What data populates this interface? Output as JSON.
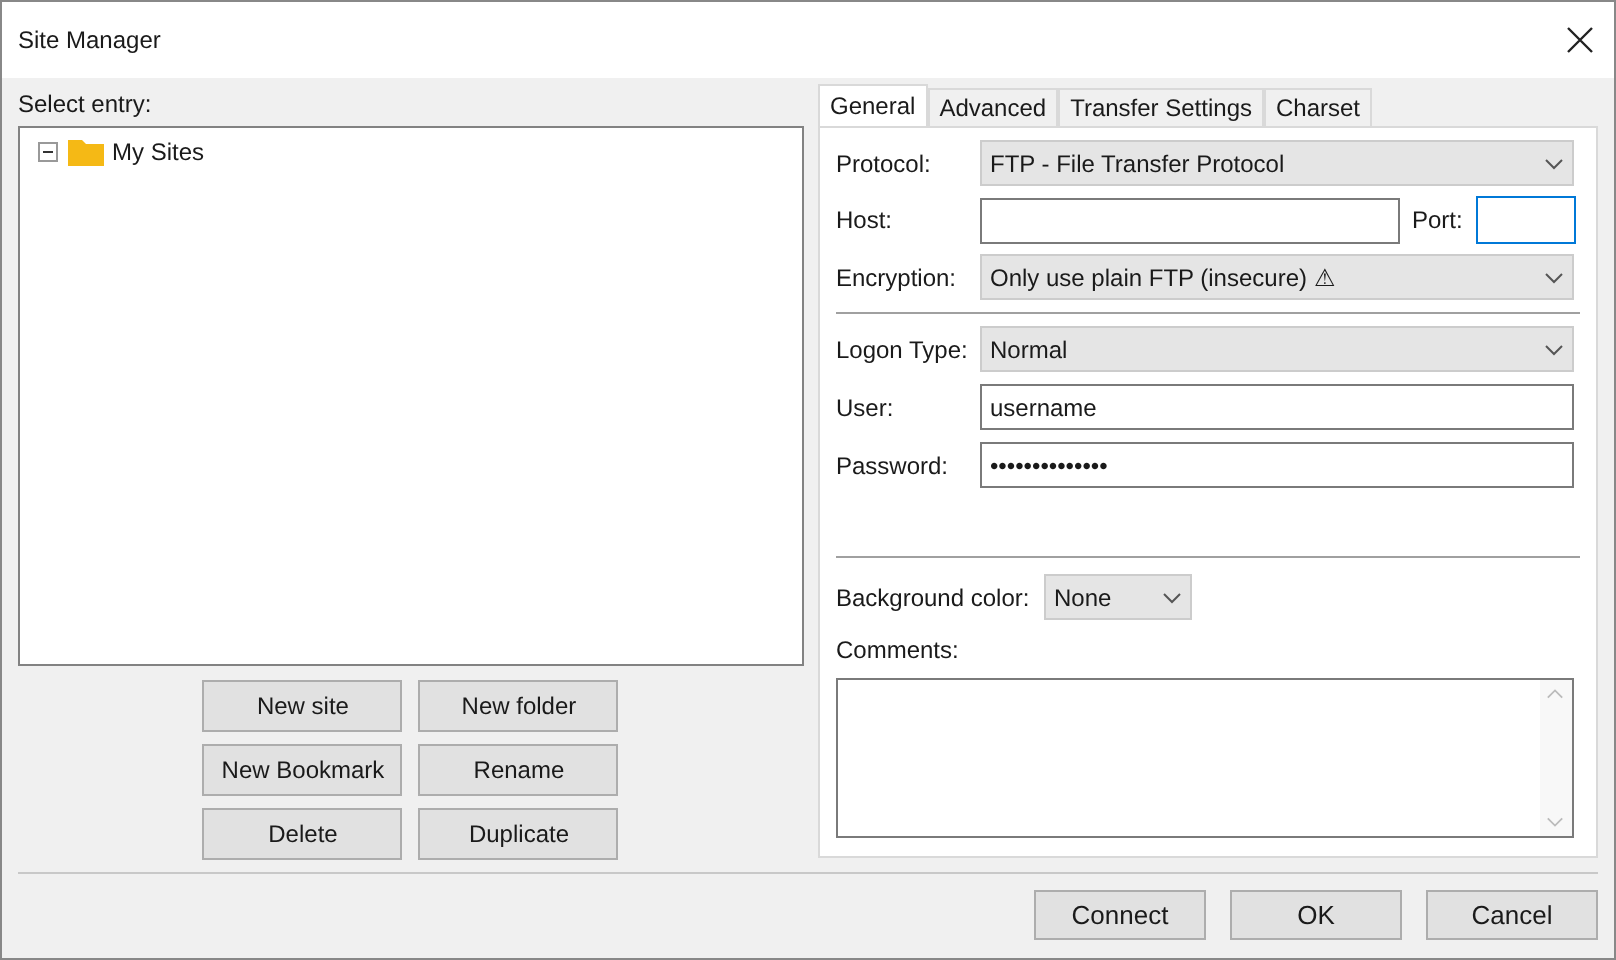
{
  "window": {
    "title": "Site Manager"
  },
  "select_entry": {
    "label": "Select entry:",
    "tree": [
      {
        "label": "My Sites",
        "expanded": true,
        "selected": false
      }
    ]
  },
  "left_buttons": [
    "New site",
    "New folder",
    "New Bookmark",
    "Rename",
    "Delete",
    "Duplicate"
  ],
  "tabs": [
    {
      "label": "General",
      "selected": true
    },
    {
      "label": "Advanced",
      "selected": false
    },
    {
      "label": "Transfer Settings",
      "selected": false
    },
    {
      "label": "Charset",
      "selected": false
    }
  ],
  "general": {
    "protocol": {
      "label": "Protocol:",
      "value": "FTP - File Transfer Protocol"
    },
    "host": {
      "label": "Host:"
    },
    "port": {
      "label": "Port:"
    },
    "encryption": {
      "label": "Encryption:",
      "value": "Only use plain FTP (insecure) ⚠"
    },
    "logon_type": {
      "label": "Logon Type:",
      "value": "Normal"
    },
    "user": {
      "label": "User:",
      "value": "username"
    },
    "password": {
      "label": "Password:",
      "value": "••••••••••••••"
    },
    "background_color": {
      "label": "Background color:",
      "value": "None"
    },
    "comments": {
      "label": "Comments:"
    }
  },
  "buttons": [
    "Connect",
    "OK",
    "Cancel"
  ]
}
